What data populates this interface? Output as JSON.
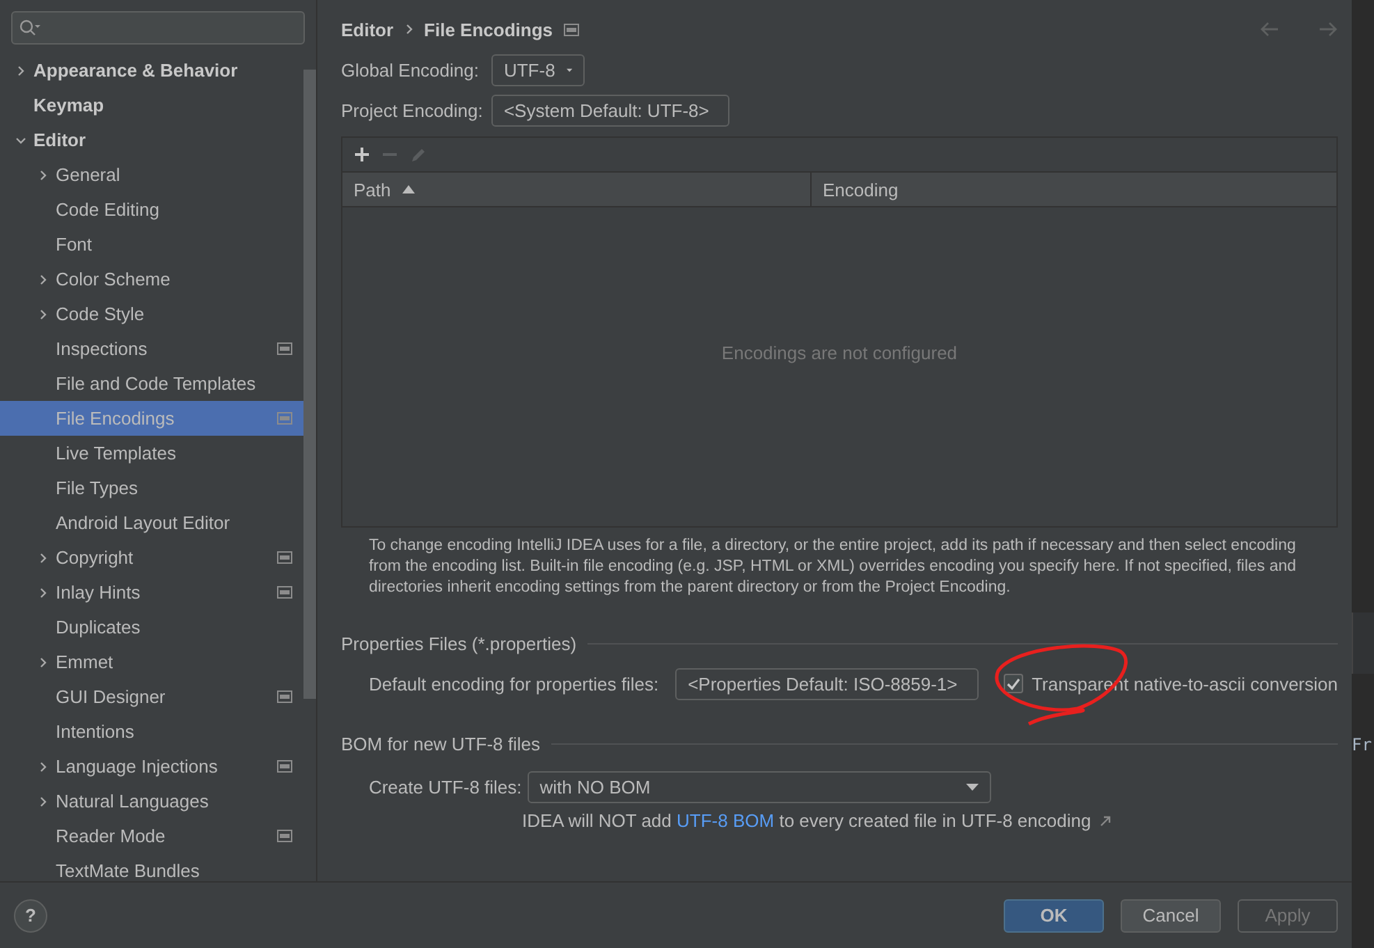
{
  "sidebar": {
    "items": [
      {
        "label": "Appearance & Behavior",
        "expandable": true,
        "expanded": false,
        "selected": false,
        "badge": false
      },
      {
        "label": "Keymap",
        "expandable": false,
        "selected": false,
        "badge": false
      },
      {
        "label": "Editor",
        "expandable": true,
        "expanded": true,
        "selected": false,
        "badge": false,
        "children": [
          {
            "label": "General",
            "expandable": true,
            "expanded": false,
            "selected": false,
            "badge": false
          },
          {
            "label": "Code Editing",
            "expandable": false,
            "selected": false,
            "badge": false
          },
          {
            "label": "Font",
            "expandable": false,
            "selected": false,
            "badge": false
          },
          {
            "label": "Color Scheme",
            "expandable": true,
            "expanded": false,
            "selected": false,
            "badge": false
          },
          {
            "label": "Code Style",
            "expandable": true,
            "expanded": false,
            "selected": false,
            "badge": false
          },
          {
            "label": "Inspections",
            "expandable": false,
            "selected": false,
            "badge": true
          },
          {
            "label": "File and Code Templates",
            "expandable": false,
            "selected": false,
            "badge": false
          },
          {
            "label": "File Encodings",
            "expandable": false,
            "selected": true,
            "badge": true
          },
          {
            "label": "Live Templates",
            "expandable": false,
            "selected": false,
            "badge": false
          },
          {
            "label": "File Types",
            "expandable": false,
            "selected": false,
            "badge": false
          },
          {
            "label": "Android Layout Editor",
            "expandable": false,
            "selected": false,
            "badge": false
          },
          {
            "label": "Copyright",
            "expandable": true,
            "expanded": false,
            "selected": false,
            "badge": true
          },
          {
            "label": "Inlay Hints",
            "expandable": true,
            "expanded": false,
            "selected": false,
            "badge": true
          },
          {
            "label": "Duplicates",
            "expandable": false,
            "selected": false,
            "badge": false
          },
          {
            "label": "Emmet",
            "expandable": true,
            "expanded": false,
            "selected": false,
            "badge": false
          },
          {
            "label": "GUI Designer",
            "expandable": false,
            "selected": false,
            "badge": true
          },
          {
            "label": "Intentions",
            "expandable": false,
            "selected": false,
            "badge": false
          },
          {
            "label": "Language Injections",
            "expandable": true,
            "expanded": false,
            "selected": false,
            "badge": true
          },
          {
            "label": "Natural Languages",
            "expandable": true,
            "expanded": false,
            "selected": false,
            "badge": false
          },
          {
            "label": "Reader Mode",
            "expandable": false,
            "selected": false,
            "badge": true
          },
          {
            "label": "TextMate Bundles",
            "expandable": false,
            "selected": false,
            "badge": false
          }
        ]
      }
    ]
  },
  "breadcrumb": [
    "Editor",
    "File Encodings"
  ],
  "global_encoding": {
    "label": "Global Encoding:",
    "value": "UTF-8"
  },
  "project_encoding": {
    "label": "Project Encoding:",
    "value": "<System Default: UTF-8>"
  },
  "mappings_table": {
    "tools": [
      {
        "kind": "add",
        "disabled": false
      },
      {
        "kind": "remove",
        "disabled": true
      },
      {
        "kind": "edit",
        "disabled": true
      }
    ],
    "columns": [
      {
        "label": "Path",
        "sorted": true
      },
      {
        "label": "Encoding",
        "sorted": false
      }
    ],
    "empty_text": "Encodings are not configured"
  },
  "description": "To change encoding IntelliJ IDEA uses for a file, a directory, or the entire project, add its path if necessary and then select encoding from the encoding list. Built-in file encoding (e.g. JSP, HTML or XML) overrides encoding you specify here. If not specified, files and directories inherit encoding settings from the parent directory or from the Project Encoding.",
  "properties_section": {
    "title": "Properties Files (*.properties)",
    "label": "Default encoding for properties files:",
    "value": "<Properties Default: ISO-8859-1>",
    "checkbox": {
      "label": "Transparent native-to-ascii conversion",
      "checked": true
    }
  },
  "bom_section": {
    "title": "BOM for new UTF-8 files",
    "label": "Create UTF-8 files:",
    "value": "with NO BOM",
    "note": {
      "before": "IDEA will NOT add",
      "link": "UTF-8 BOM",
      "after": "to every created file in UTF-8 encoding"
    }
  },
  "help": "?",
  "buttons": [
    {
      "label": "OK",
      "kind": "primary",
      "disabled": false
    },
    {
      "label": "Cancel",
      "kind": "normal",
      "disabled": false
    },
    {
      "label": "Apply",
      "kind": "normal",
      "disabled": true
    }
  ],
  "background_window": {
    "text": "Fr"
  }
}
